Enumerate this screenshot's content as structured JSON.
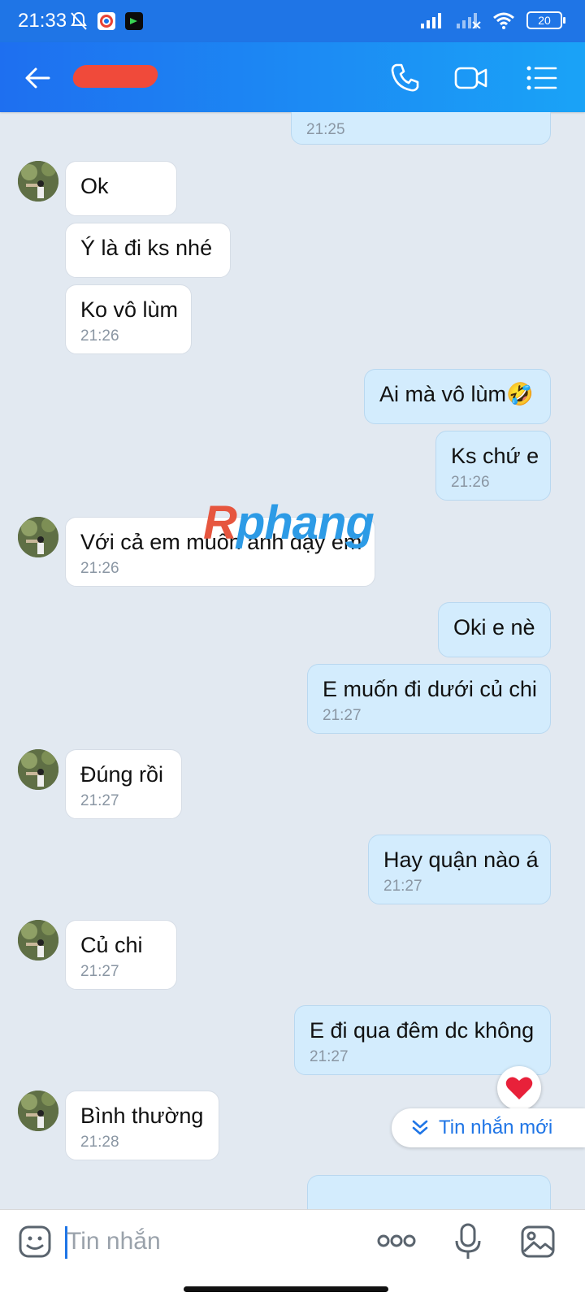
{
  "status": {
    "time": "21:33",
    "battery": "20"
  },
  "header": {
    "contact_name_redacted": ""
  },
  "partial_top": {
    "time": "21:25"
  },
  "messages": [
    {
      "dir": "in",
      "text": "Ok",
      "time": ""
    },
    {
      "dir": "in",
      "text": "Ý là đi ks nhé",
      "time": ""
    },
    {
      "dir": "in",
      "text": "Ko vô lùm",
      "time": "21:26"
    },
    {
      "dir": "out",
      "text": "Ai mà vô lùm🤣",
      "time": ""
    },
    {
      "dir": "out",
      "text": "Ks chứ e",
      "time": "21:26"
    },
    {
      "dir": "in",
      "text": "Với cả em muốn anh dạy em",
      "time": "21:26"
    },
    {
      "dir": "out",
      "text": "Oki e nè",
      "time": ""
    },
    {
      "dir": "out",
      "text": "E muốn đi dưới củ chi",
      "time": "21:27"
    },
    {
      "dir": "in",
      "text": "Đúng rồi",
      "time": "21:27"
    },
    {
      "dir": "out",
      "text": "Hay quận nào á",
      "time": "21:27"
    },
    {
      "dir": "in",
      "text": "Củ chi",
      "time": "21:27"
    },
    {
      "dir": "out",
      "text": "E đi qua đêm dc không",
      "time": "21:27"
    },
    {
      "dir": "in",
      "text": "Bình thường",
      "time": "21:28"
    }
  ],
  "watermark": {
    "first": "R",
    "rest": "phang"
  },
  "new_messages_label": "Tin nhắn mới",
  "composer": {
    "placeholder": "Tin nhắn"
  },
  "colors": {
    "header": "#1f75e6",
    "incoming": "#ffffff",
    "outgoing": "#d3ecfd",
    "accent": "#1f75e6"
  }
}
